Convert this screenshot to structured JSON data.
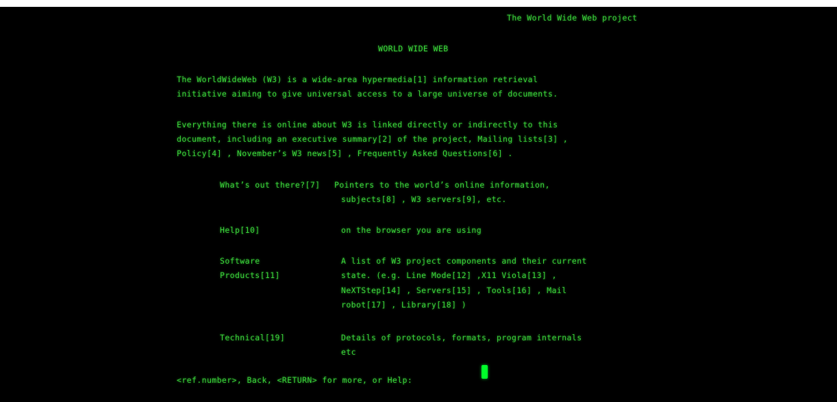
{
  "header": {
    "title": "The World Wide Web project"
  },
  "heading": "WORLD WIDE WEB",
  "paragraphs": [
    [
      "The WorldWideWeb (W3) is a wide-area hypermedia[1] information retrieval",
      "initiative aiming to give universal access to a large universe of documents."
    ],
    [
      "Everything there is online about W3 is linked directly or indirectly to this",
      "document, including an executive summary[2] of the project, Mailing lists[3] ,",
      "Policy[4] , November’s W3 news[5] , Frequently Asked Questions[6] ."
    ]
  ],
  "entries": [
    {
      "label": [
        "What’s out there?[7]"
      ],
      "desc": [
        "Pointers to the world’s online information,",
        "subjects[8] , W3 servers[9], etc."
      ]
    },
    {
      "label": [
        "Help[10]"
      ],
      "desc": [
        "on the browser you are using"
      ]
    },
    {
      "label": [
        "Software",
        "Products[11]"
      ],
      "desc": [
        "A list of W3 project components and their current",
        "state. (e.g. Line Mode[12] ,X11 Viola[13] ,",
        "NeXTStep[14] , Servers[15] , Tools[16] , Mail",
        "robot[17] , Library[18] )"
      ]
    },
    {
      "label": [
        "Technical[19]"
      ],
      "desc": [
        "Details of protocols, formats, program internals",
        "etc"
      ]
    }
  ],
  "prompt": "<ref.number>, Back, <RETURN> for more, or Help:",
  "colors": {
    "text": "#3bd83b",
    "background": "#000000",
    "cursor": "#00ff2a"
  }
}
